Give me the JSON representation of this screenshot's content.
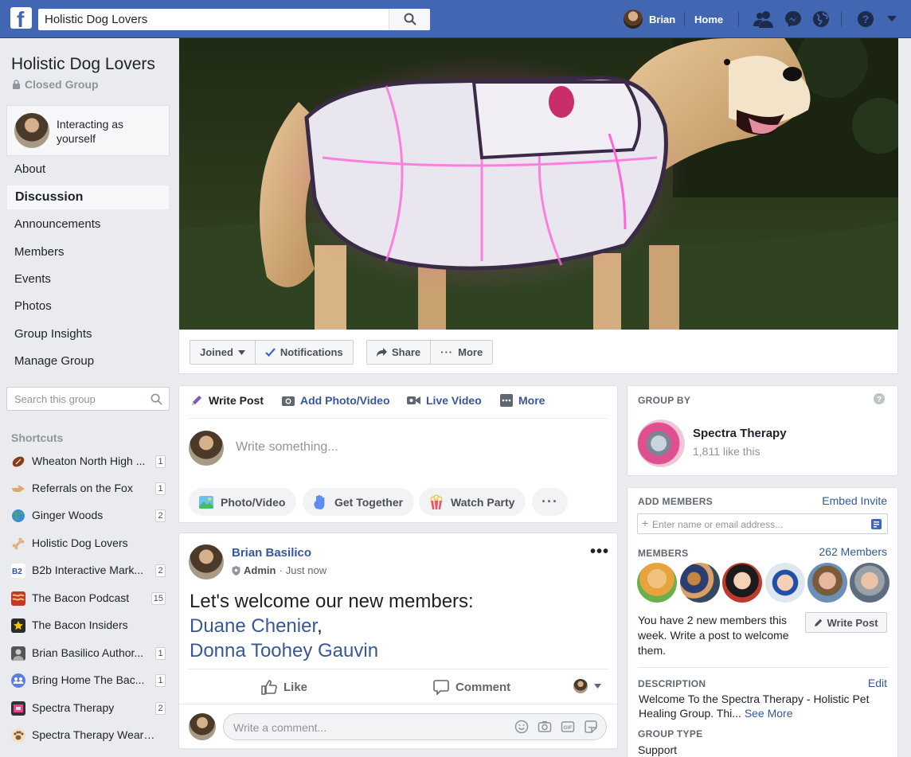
{
  "topbar": {
    "logo": "f",
    "search_value": "Holistic Dog Lovers",
    "profile_name": "Brian",
    "home_label": "Home",
    "icons": [
      "search-icon",
      "friends-icon",
      "messenger-icon",
      "globe-icon",
      "help-icon",
      "caret-down-icon"
    ]
  },
  "sidebar": {
    "group_title": "Holistic Dog Lovers",
    "privacy": "Closed Group",
    "interacting": "Interacting as yourself",
    "nav": [
      {
        "label": "About"
      },
      {
        "label": "Discussion",
        "active": true
      },
      {
        "label": "Announcements"
      },
      {
        "label": "Members"
      },
      {
        "label": "Events"
      },
      {
        "label": "Photos"
      },
      {
        "label": "Group Insights"
      },
      {
        "label": "Manage Group"
      }
    ],
    "search_placeholder": "Search this group",
    "shortcuts_header": "Shortcuts",
    "shortcuts": [
      {
        "label": "Wheaton North High ...",
        "count": "1",
        "icon": "football-icon"
      },
      {
        "label": "Referrals on the Fox",
        "count": "1",
        "icon": "pointing-hand-icon"
      },
      {
        "label": "Ginger Woods",
        "count": "2",
        "icon": "globe-icon"
      },
      {
        "label": "Holistic Dog Lovers",
        "count": "",
        "icon": "bone-icon"
      },
      {
        "label": "B2b Interactive Mark...",
        "count": "2",
        "icon": "b2b-icon"
      },
      {
        "label": "The Bacon Podcast",
        "count": "15",
        "icon": "bacon-icon"
      },
      {
        "label": "The Bacon Insiders",
        "count": "",
        "icon": "star-icon"
      },
      {
        "label": "Brian Basilico Author...",
        "count": "1",
        "icon": "author-icon"
      },
      {
        "label": "Bring Home The Bac...",
        "count": "1",
        "icon": "group-icon"
      },
      {
        "label": "Spectra Therapy",
        "count": "2",
        "icon": "spectra-icon"
      },
      {
        "label": "Spectra Therapy Weara...",
        "count": "",
        "icon": "paw-icon"
      }
    ]
  },
  "cover_actions": {
    "joined": "Joined",
    "notifications": "Notifications",
    "share": "Share",
    "more": "More"
  },
  "composer": {
    "tabs": [
      "Write Post",
      "Add Photo/Video",
      "Live Video",
      "More"
    ],
    "placeholder": "Write something...",
    "chips": [
      "Photo/Video",
      "Get Together",
      "Watch Party"
    ]
  },
  "post": {
    "author": "Brian Basilico",
    "role": "Admin",
    "time": "Just now",
    "body_line1": "Let's welcome our new members:",
    "member1": "Duane Chenier",
    "member2": "Donna Toohey Gauvin",
    "like": "Like",
    "comment": "Comment",
    "comment_placeholder": "Write a comment..."
  },
  "right": {
    "group_by_header": "GROUP BY",
    "owner_name": "Spectra Therapy",
    "owner_likes": "1,811 like this",
    "add_members_header": "ADD MEMBERS",
    "embed_invite": "Embed Invite",
    "add_placeholder": "Enter name or email address...",
    "members_header": "MEMBERS",
    "members_count": "262 Members",
    "new_members_text": "You have 2 new members this week. Write a post to welcome them.",
    "write_post": "Write Post",
    "description_header": "DESCRIPTION",
    "edit": "Edit",
    "description": "Welcome To the Spectra Therapy - Holistic Pet Healing Group. Thi...",
    "see_more": "See More",
    "group_type_header": "GROUP TYPE",
    "group_type": "Support"
  },
  "colors": {
    "brand": "#4267b2",
    "link": "#365899",
    "bg": "#e9ebee"
  }
}
